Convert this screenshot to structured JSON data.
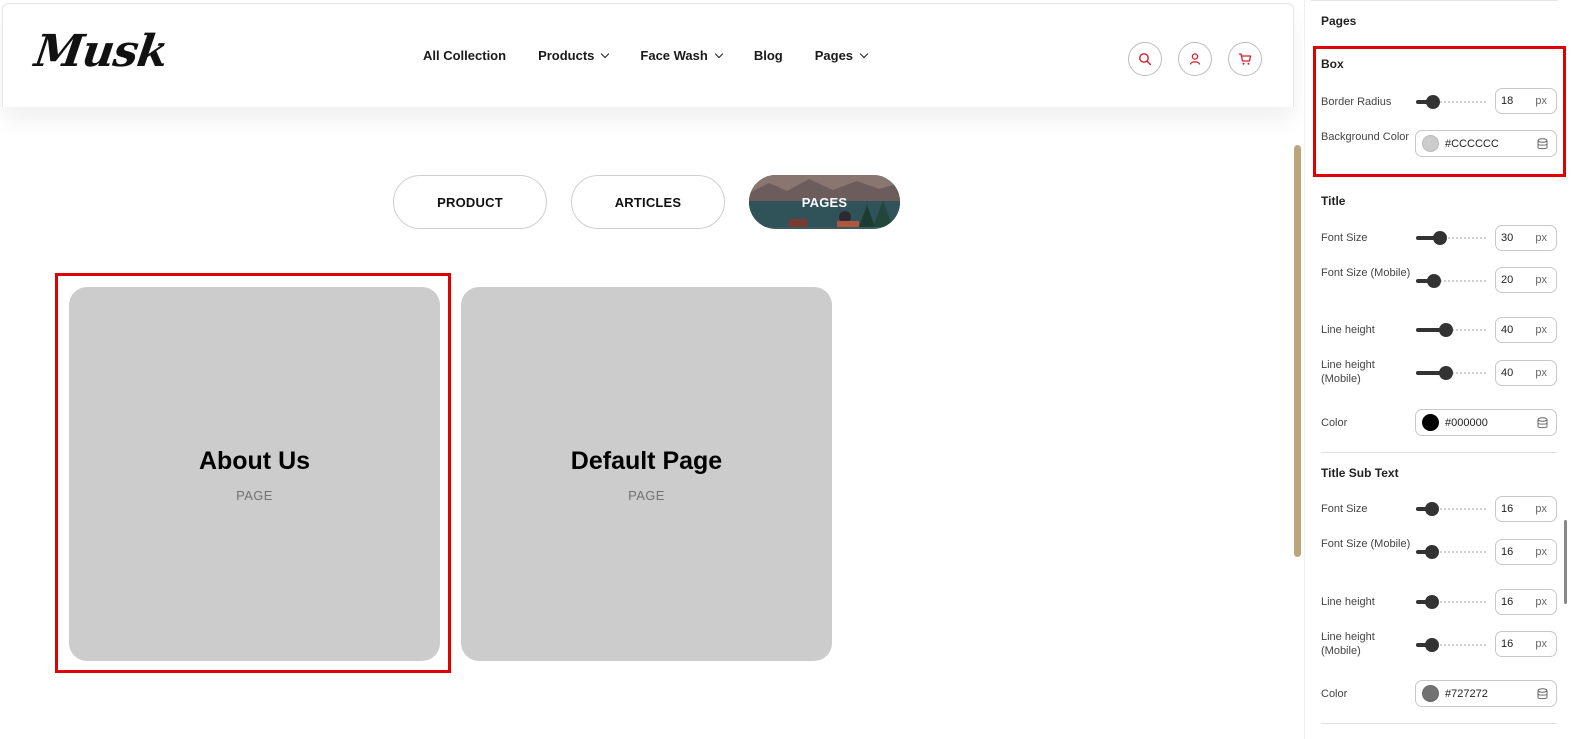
{
  "store": {
    "logo": "Musk",
    "nav": [
      {
        "label": "All Collection",
        "dropdown": false
      },
      {
        "label": "Products",
        "dropdown": true
      },
      {
        "label": "Face Wash",
        "dropdown": true
      },
      {
        "label": "Blog",
        "dropdown": false
      },
      {
        "label": "Pages",
        "dropdown": true
      }
    ],
    "header_icons": [
      "search-icon",
      "user-icon",
      "cart-icon"
    ],
    "accent": "#e00000"
  },
  "tabs": [
    {
      "label": "PRODUCT",
      "active": false
    },
    {
      "label": "ARTICLES",
      "active": false
    },
    {
      "label": "PAGES",
      "active": true
    }
  ],
  "cards": [
    {
      "title": "About Us",
      "subtitle": "PAGE"
    },
    {
      "title": "Default Page",
      "subtitle": "PAGE"
    }
  ],
  "panel": {
    "header": "Pages",
    "box": {
      "heading": "Box",
      "border_radius": {
        "label": "Border Radius",
        "value": "18",
        "unit": "px"
      },
      "background_color": {
        "label": "Background Color",
        "value": "#CCCCCC",
        "swatch": "#cccccc"
      }
    },
    "title": {
      "heading": "Title",
      "font_size": {
        "label": "Font Size",
        "value": "30",
        "unit": "px"
      },
      "font_size_mobile": {
        "label": "Font Size (Mobile)",
        "value": "20",
        "unit": "px"
      },
      "line_height": {
        "label": "Line height",
        "value": "40",
        "unit": "px"
      },
      "line_height_mobile": {
        "label": "Line height (Mobile)",
        "value": "40",
        "unit": "px"
      },
      "color": {
        "label": "Color",
        "value": "#000000",
        "swatch": "#000000"
      }
    },
    "sub_text": {
      "heading": "Title Sub Text",
      "font_size": {
        "label": "Font Size",
        "value": "16",
        "unit": "px"
      },
      "font_size_mobile": {
        "label": "Font Size (Mobile)",
        "value": "16",
        "unit": "px"
      },
      "line_height": {
        "label": "Line height",
        "value": "16",
        "unit": "px"
      },
      "line_height_mobile": {
        "label": "Line height (Mobile)",
        "value": "16",
        "unit": "px"
      },
      "color": {
        "label": "Color",
        "value": "#727272",
        "swatch": "#727272"
      }
    }
  }
}
